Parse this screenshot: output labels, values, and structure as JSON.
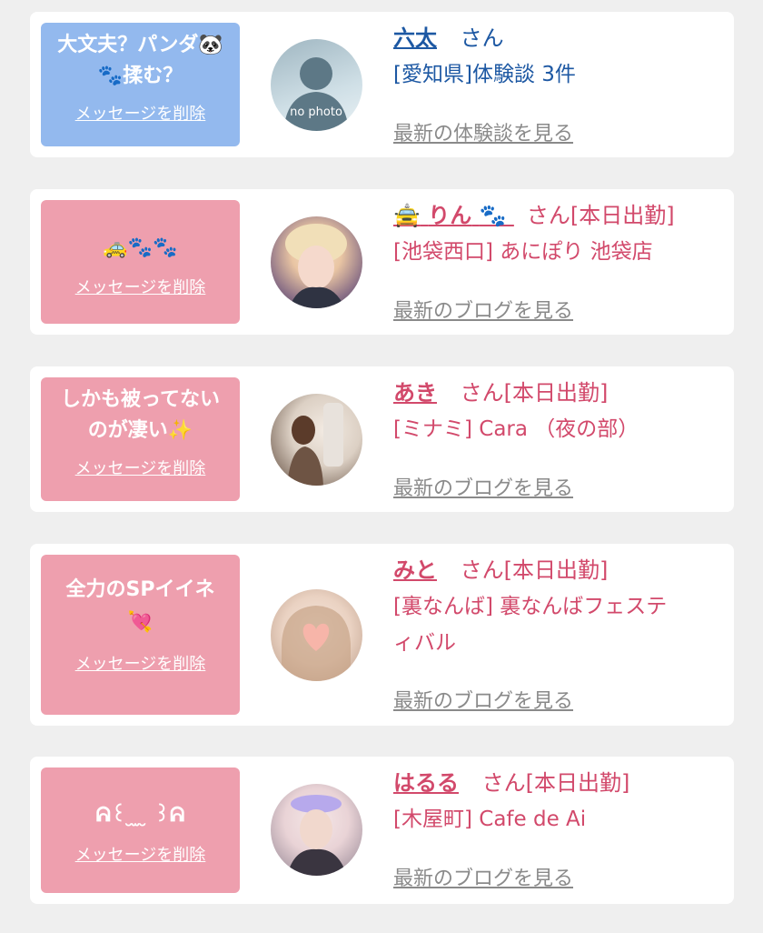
{
  "messages": [
    {
      "bubble_line1": "大文夫？パンダ🐼",
      "bubble_line2": "🐾揉む？",
      "delete_label": "メッセージを削除",
      "name": "六太",
      "suffix": "さん",
      "detail": "[愛知県]体験談 3件",
      "more_label": "最新の体験談を見る",
      "avatar_text": "no photo",
      "theme": "blue"
    },
    {
      "bubble_line1": "🚕🐾🐾",
      "delete_label": "メッセージを削除",
      "name_prefix_emoji": "🚖",
      "name": "りん",
      "name_suffix_emoji": "🐾",
      "suffix": "さん[本日出勤]",
      "detail": "[池袋西口] あにぽり 池袋店",
      "more_label": "最新のブログを見る",
      "theme": "pink"
    },
    {
      "bubble_line1": "しかも被ってない",
      "bubble_line2": "のが凄い✨",
      "delete_label": "メッセージを削除",
      "name": "あき",
      "suffix": "さん[本日出勤]",
      "detail": "[ミナミ] Cara （夜の部）",
      "more_label": "最新のブログを見る",
      "theme": "pink"
    },
    {
      "bubble_line1": "全力のSPイイネ",
      "bubble_line2": "💘",
      "delete_label": "メッセージを削除",
      "name": "みと",
      "suffix": "さん[本日出勤]",
      "detail_line1": "[裏なんば] 裏なんばフェステ",
      "detail_line2": "ィバル",
      "more_label": "最新のブログを見る",
      "theme": "pink"
    },
    {
      "bubble_line1": "ᕱ꒰ ̮ ̫ ̮ ꒱ᕱ",
      "delete_label": "メッセージを削除",
      "name": "はるる",
      "suffix": "さん[本日出勤]",
      "detail": "[木屋町] Cafe de Ai",
      "more_label": "最新のブログを見る",
      "theme": "pink"
    }
  ],
  "colors": {
    "page_bg": "#efefef",
    "card_bg": "#ffffff",
    "bubble_blue": "#93b9ee",
    "bubble_pink": "#ee9fae",
    "name_blue": "#1d58a3",
    "name_pink": "#d2496b",
    "more_gray": "#8a8a8a"
  }
}
